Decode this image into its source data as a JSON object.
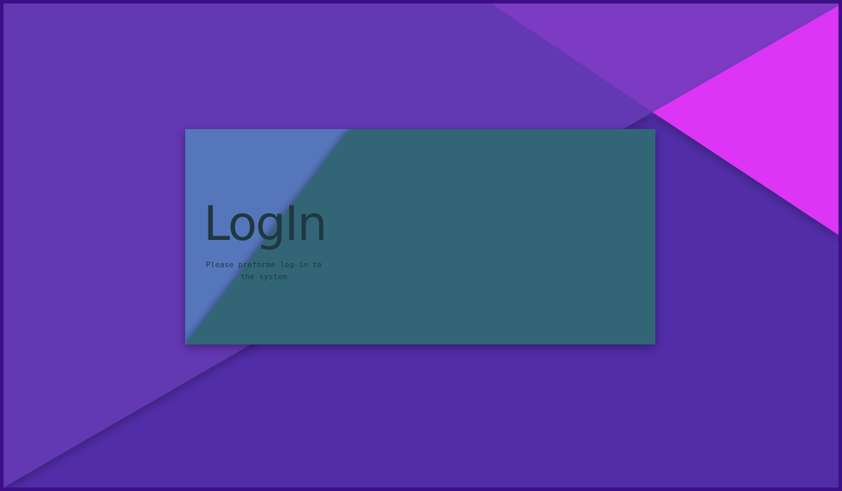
{
  "login": {
    "title": "LogIn",
    "subtitle": "Please preforme log-in to the system"
  },
  "colors": {
    "background": "#512da8",
    "background_panel": "#6338b3",
    "accent_triangle": "#7c3bc2",
    "accent_pink": "#dc36f5",
    "card_teal": "#326677",
    "card_blue": "#5676bc",
    "text": "#1f3841",
    "border": "#3d0f86"
  }
}
